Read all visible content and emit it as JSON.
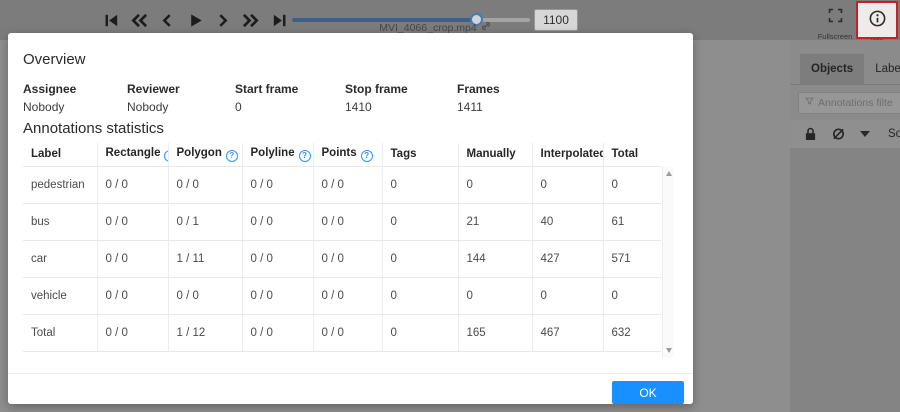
{
  "colors": {
    "accent": "#1890ff",
    "info_highlight_border": "#c92121",
    "slider_fill": "#3c6088",
    "overlay_gray": "#8e8e8e"
  },
  "toolbar": {
    "controls": [
      "first-frame",
      "backward",
      "previous",
      "play",
      "next",
      "forward",
      "last-frame"
    ],
    "filename": "MVI_4066_crop.mp4",
    "frame_value": "1100",
    "fullscreen_label": "Fullscreen",
    "info_label": "Info"
  },
  "sidebar": {
    "tabs": [
      {
        "label": "Objects",
        "active": true
      },
      {
        "label": "Labels",
        "active": false
      }
    ],
    "filter_placeholder": "Annotations filte",
    "sort_label": "So"
  },
  "modal": {
    "overview": {
      "title": "Overview",
      "fields": [
        {
          "label": "Assignee",
          "value": "Nobody"
        },
        {
          "label": "Reviewer",
          "value": "Nobody"
        },
        {
          "label": "Start frame",
          "value": "0"
        },
        {
          "label": "Stop frame",
          "value": "1410"
        },
        {
          "label": "Frames",
          "value": "1411"
        }
      ]
    },
    "statistics": {
      "title": "Annotations statistics",
      "columns": [
        "Label",
        "Rectangle",
        "Polygon",
        "Polyline",
        "Points",
        "Tags",
        "Manually",
        "Interpolated",
        "Total"
      ],
      "rows": [
        [
          "pedestrian",
          "0 / 0",
          "0 / 0",
          "0 / 0",
          "0 / 0",
          "0",
          "0",
          "0",
          "0"
        ],
        [
          "bus",
          "0 / 0",
          "0 / 1",
          "0 / 0",
          "0 / 0",
          "0",
          "21",
          "40",
          "61"
        ],
        [
          "car",
          "0 / 0",
          "1 / 11",
          "0 / 0",
          "0 / 0",
          "0",
          "144",
          "427",
          "571"
        ],
        [
          "vehicle",
          "0 / 0",
          "0 / 0",
          "0 / 0",
          "0 / 0",
          "0",
          "0",
          "0",
          "0"
        ],
        [
          "Total",
          "0 / 0",
          "1 / 12",
          "0 / 0",
          "0 / 0",
          "0",
          "165",
          "467",
          "632"
        ]
      ]
    },
    "ok_label": "OK"
  },
  "icons": {
    "help_glyph": "?"
  }
}
